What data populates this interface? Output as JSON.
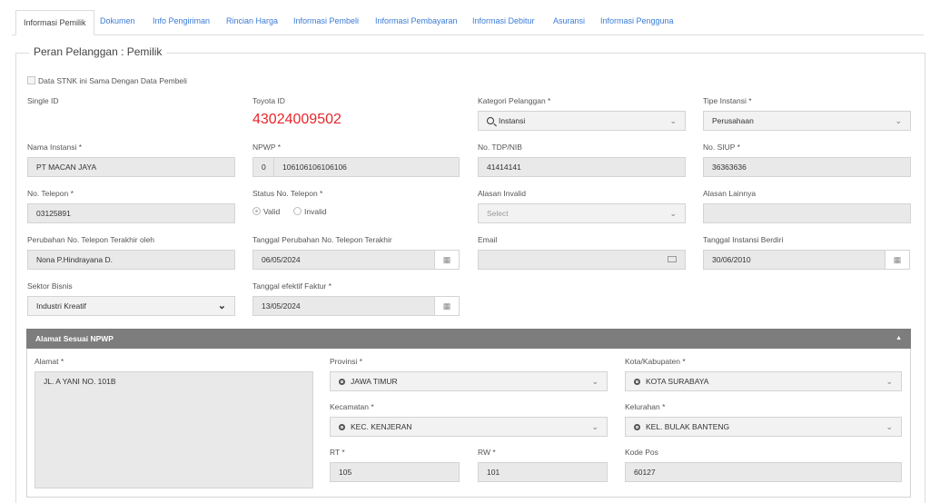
{
  "tabs": [
    "Informasi Pemilik",
    "Dokumen",
    "Info Pengiriman",
    "Rincian Harga",
    "Informasi Pembeli",
    "Informasi Pembayaran",
    "Informasi Debitur",
    "Asuransi",
    "Informasi Pengguna"
  ],
  "section_title": "Peran Pelanggan : Pemilik",
  "checkbox_label": "Data STNK ini Sama Dengan Data Pembeli",
  "fields": {
    "single_id": {
      "label": "Single ID",
      "value": ""
    },
    "toyota_id": {
      "label": "Toyota ID",
      "value": "43024009502"
    },
    "kategori_pelanggan": {
      "label": "Kategori Pelanggan *",
      "value": "Instansi"
    },
    "tipe_instansi": {
      "label": "Tipe Instansi *",
      "value": "Perusahaan"
    },
    "nama_instansi": {
      "label": "Nama Instansi *",
      "value": "PT MACAN JAYA"
    },
    "npwp": {
      "label": "NPWP *",
      "prefix": "0",
      "value": "106106106106106"
    },
    "no_tdp": {
      "label": "No. TDP/NIB",
      "value": "41414141"
    },
    "no_siup": {
      "label": "No. SIUP *",
      "value": "36363636"
    },
    "no_telepon": {
      "label": "No. Telepon *",
      "value": "03125891"
    },
    "status_telepon": {
      "label": "Status No. Telepon *",
      "options": [
        "Valid",
        "Invalid"
      ],
      "selected": "Valid"
    },
    "alasan_invalid": {
      "label": "Alasan Invalid",
      "placeholder": "Select"
    },
    "alasan_lainnya": {
      "label": "Alasan Lainnya",
      "value": ""
    },
    "perubahan_telepon_oleh": {
      "label": "Perubahan No. Telepon Terakhir oleh",
      "value": "Nona P.Hindrayana D."
    },
    "tanggal_perubahan": {
      "label": "Tanggal Perubahan No. Telepon Terakhir",
      "value": "06/05/2024"
    },
    "email": {
      "label": "Email",
      "value": ""
    },
    "tanggal_berdiri": {
      "label": "Tanggal Instansi Berdiri",
      "value": "30/06/2010"
    },
    "sektor_bisnis": {
      "label": "Sektor Bisnis",
      "value": "Industri Kreatif"
    },
    "tanggal_faktur": {
      "label": "Tanggal efektif Faktur *",
      "value": "13/05/2024"
    }
  },
  "address_panel": {
    "title": "Alamat Sesuai NPWP",
    "alamat": {
      "label": "Alamat *",
      "value": "JL. A YANI NO. 101B"
    },
    "provinsi": {
      "label": "Provinsi *",
      "value": "JAWA TIMUR"
    },
    "kota": {
      "label": "Kota/Kabupaten *",
      "value": "KOTA SURABAYA"
    },
    "kecamatan": {
      "label": "Kecamatan *",
      "value": "KEC. KENJERAN"
    },
    "kelurahan": {
      "label": "Kelurahan *",
      "value": "KEL. BULAK BANTENG"
    },
    "rt": {
      "label": "RT *",
      "value": "105"
    },
    "rw": {
      "label": "RW *",
      "value": "101"
    },
    "kode_pos": {
      "label": "Kode Pos",
      "value": "60127"
    }
  },
  "colors": {
    "tab_link": "#3a7bd5",
    "toyota_id": "#e8262b",
    "panel_header": "#7d7d7d",
    "input_bg": "#e9e9e9"
  }
}
